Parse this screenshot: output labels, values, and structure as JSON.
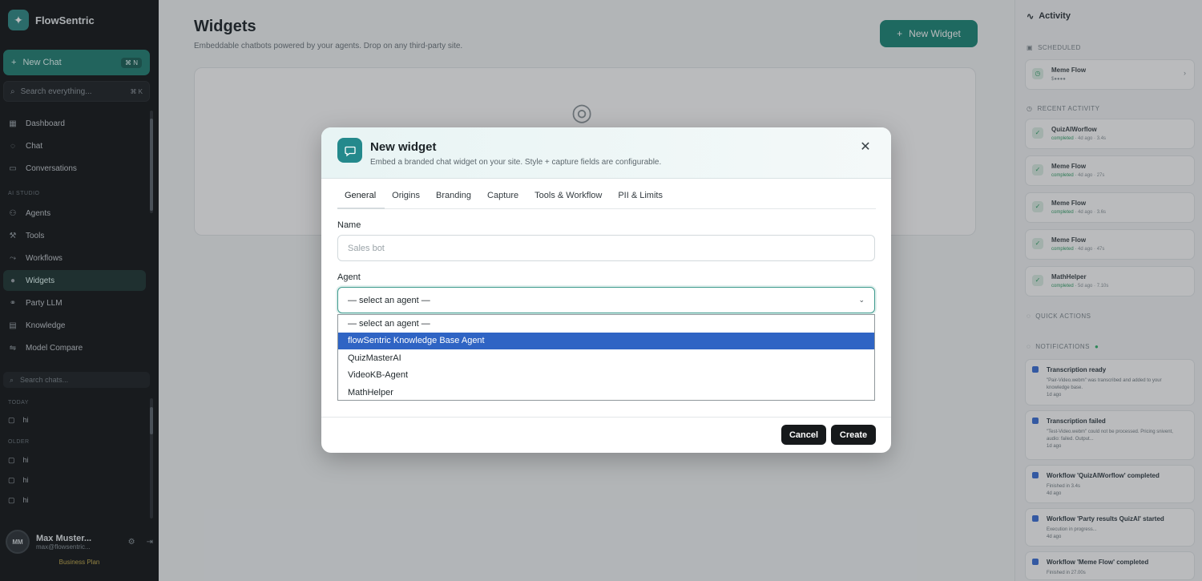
{
  "sidebar": {
    "brand": "FlowSentric",
    "new_chat": {
      "label": "New Chat",
      "shortcut": "⌘ N"
    },
    "search": {
      "placeholder": "Search everything...",
      "shortcut": "⌘ K"
    },
    "nav_top": [
      {
        "label": "Dashboard",
        "icon": "grid-icon"
      },
      {
        "label": "Chat",
        "icon": "chat-icon"
      },
      {
        "label": "Conversations",
        "icon": "conversations-icon"
      }
    ],
    "section_studio": "AI STUDIO",
    "nav_studio": [
      {
        "label": "Agents",
        "icon": "agents-icon"
      },
      {
        "label": "Tools",
        "icon": "wrench-icon"
      },
      {
        "label": "Workflows",
        "icon": "workflow-icon"
      },
      {
        "label": "Widgets",
        "icon": "widgets-icon",
        "active": true
      },
      {
        "label": "Party LLM",
        "icon": "party-icon"
      },
      {
        "label": "Knowledge",
        "icon": "book-icon"
      },
      {
        "label": "Model Compare",
        "icon": "compare-icon"
      }
    ],
    "chat_search_placeholder": "Search chats...",
    "section_today": "TODAY",
    "today_items": [
      "hi"
    ],
    "section_older": "OLDER",
    "older_items": [
      "hi",
      "hi",
      "hi"
    ],
    "user": {
      "initials": "MM",
      "name": "Max Muster...",
      "email": "max@flowsentric..."
    },
    "plan": "Business Plan"
  },
  "main": {
    "title": "Widgets",
    "subtitle": "Embeddable chatbots powered by your agents. Drop on any third-party site.",
    "new_widget_label": "New Widget"
  },
  "right_panel": {
    "title": "Activity",
    "scheduled_label": "SCHEDULED",
    "scheduled": [
      {
        "title": "Meme Flow",
        "sub": "$●●●●"
      }
    ],
    "recent_label": "RECENT ACTIVITY",
    "recent": [
      {
        "title": "QuizAIWorflow",
        "status": "completed",
        "meta": "4d ago · 3.4s"
      },
      {
        "title": "Meme Flow",
        "status": "completed",
        "meta": "4d ago · 27s"
      },
      {
        "title": "Meme Flow",
        "status": "completed",
        "meta": "4d ago · 3.6s"
      },
      {
        "title": "Meme Flow",
        "status": "completed",
        "meta": "4d ago · 47s"
      },
      {
        "title": "MathHelper",
        "status": "completed",
        "meta": "5d ago · 7.10s"
      }
    ],
    "quick_actions_label": "QUICK ACTIONS",
    "notifications_label": "NOTIFICATIONS",
    "notifications": [
      {
        "title": "Transcription ready",
        "body": "\"Pair-Video.webm\" was transcribed and added to your knowledge base.",
        "time": "1d ago"
      },
      {
        "title": "Transcription failed",
        "body": "\"Test-Video.webm\" could not be processed. Pricing snivent, audio: failed. Output...",
        "time": "1d ago"
      },
      {
        "title": "Workflow 'QuizAIWorflow' completed",
        "body": "Finished in 3.4s",
        "time": "4d ago"
      },
      {
        "title": "Workflow 'Party results QuizAI' started",
        "body": "Execution in progress...",
        "time": "4d ago"
      },
      {
        "title": "Workflow 'Meme Flow' completed",
        "body": "Finished in 27.00s",
        "time": ""
      }
    ]
  },
  "modal": {
    "title": "New widget",
    "subtitle": "Embed a branded chat widget on your site. Style + capture fields are configurable.",
    "tabs": [
      "General",
      "Origins",
      "Branding",
      "Capture",
      "Tools & Workflow",
      "PII & Limits"
    ],
    "active_tab": "General",
    "name_label": "Name",
    "name_placeholder": "Sales bot",
    "agent_label": "Agent",
    "agent_selected": "— select an agent —",
    "agent_options": [
      "— select an agent —",
      "flowSentric Knowledge Base Agent",
      "QuizMasterAI",
      "VideoKB-Agent",
      "MathHelper"
    ],
    "highlighted_option": "flowSentric Knowledge Base Agent",
    "cancel_label": "Cancel",
    "create_label": "Create"
  },
  "colors": {
    "accent": "#1a8777",
    "sidebar_bg": "#111416",
    "highlight": "#2f64c4"
  }
}
